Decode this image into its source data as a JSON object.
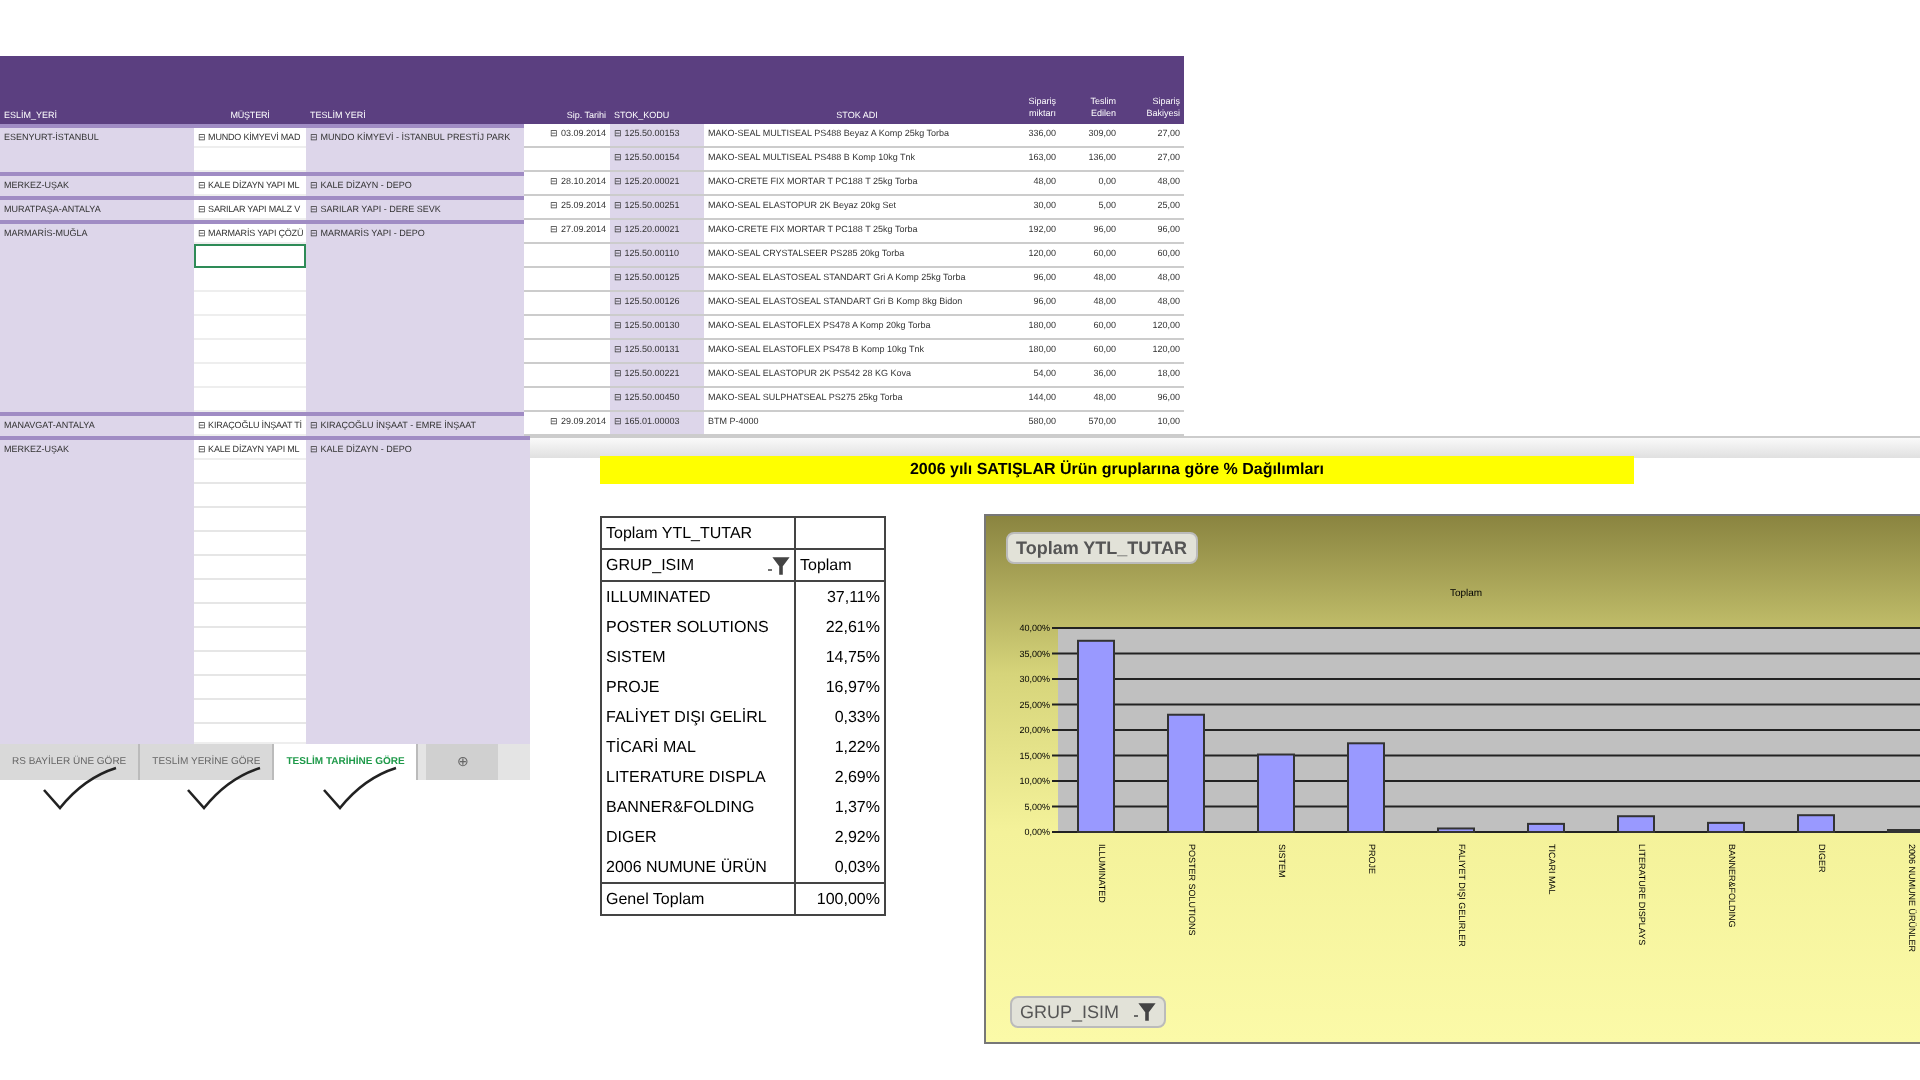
{
  "order_sheet": {
    "columns": [
      {
        "label": "ESLİM_YERİ"
      },
      {
        "label": "MÜŞTERİ"
      },
      {
        "label": "TESLİM YERİ"
      },
      {
        "label": "Sip. Tarihi"
      },
      {
        "label": "STOK_KODU"
      },
      {
        "label": "STOK ADI"
      },
      {
        "label": "Sipariş miktarı"
      },
      {
        "label": "Teslim Edilen"
      },
      {
        "label": "Sipariş Bakiyesi"
      }
    ],
    "rows": [
      {
        "location": "ESENYURT-İSTANBUL",
        "customer": "⊟ MUNDO KİMYEVİ MAD",
        "site": "⊟ MUNDO KİMYEVİ - İSTANBUL PRESTİJ PARK",
        "date": "⊟ 03.09.2014",
        "code": "⊟ 125.50.00153",
        "name": "MAKO-SEAL MULTISEAL PS488 Beyaz A Komp 25kg Torba",
        "ordered": "336,00",
        "delivered": "309,00",
        "balance": "27,00",
        "active": false
      },
      {
        "code": "⊟ 125.50.00154",
        "name": "MAKO-SEAL MULTISEAL PS488 B Komp 10kg Tnk",
        "ordered": "163,00",
        "delivered": "136,00",
        "balance": "27,00",
        "active": false
      },
      {
        "location": "MERKEZ-UŞAK",
        "customer": "⊟ KALE DİZAYN YAPI ML",
        "site": "⊟ KALE DİZAYN - DEPO",
        "date": "⊟ 28.10.2014",
        "code": "⊟ 125.20.00021",
        "name": "MAKO-CRETE FIX MORTAR T PC188 T 25kg Torba",
        "ordered": "48,00",
        "delivered": "0,00",
        "balance": "48,00",
        "active": false
      },
      {
        "location": "MURATPAŞA-ANTALYA",
        "customer": "⊟ SARILAR YAPI MALZ V",
        "site": "⊟ SARILAR YAPI - DERE SEVK",
        "date": "⊟ 25.09.2014",
        "code": "⊟ 125.50.00251",
        "name": "MAKO-SEAL ELASTOPUR 2K Beyaz 20kg Set",
        "ordered": "30,00",
        "delivered": "5,00",
        "balance": "25,00",
        "active": false
      },
      {
        "location": "MARMARİS-MUĞLA",
        "customer": "⊟ MARMARİS YAPI ÇÖZÜ",
        "site": "⊟ MARMARİS YAPI - DEPO",
        "date": "⊟ 27.09.2014",
        "code": "⊟ 125.20.00021",
        "name": "MAKO-CRETE FIX MORTAR T PC188 T 25kg Torba",
        "ordered": "192,00",
        "delivered": "96,00",
        "balance": "96,00",
        "active": false
      },
      {
        "code": "⊟ 125.50.00110",
        "name": "MAKO-SEAL CRYSTALSEER PS285 20kg Torba",
        "ordered": "120,00",
        "delivered": "60,00",
        "balance": "60,00",
        "active": true
      },
      {
        "code": "⊟ 125.50.00125",
        "name": "MAKO-SEAL ELASTOSEAL STANDART Gri A Komp 25kg Torba",
        "ordered": "96,00",
        "delivered": "48,00",
        "balance": "48,00",
        "active": false
      },
      {
        "code": "⊟ 125.50.00126",
        "name": "MAKO-SEAL ELASTOSEAL STANDART Gri B Komp 8kg Bidon",
        "ordered": "96,00",
        "delivered": "48,00",
        "balance": "48,00",
        "active": false
      },
      {
        "code": "⊟ 125.50.00130",
        "name": "MAKO-SEAL ELASTOFLEX PS478 A Komp 20kg Torba",
        "ordered": "180,00",
        "delivered": "60,00",
        "balance": "120,00",
        "active": false
      },
      {
        "code": "⊟ 125.50.00131",
        "name": "MAKO-SEAL ELASTOFLEX PS478 B Komp 10kg Tnk",
        "ordered": "180,00",
        "delivered": "60,00",
        "balance": "120,00",
        "active": false
      },
      {
        "code": "⊟ 125.50.00221",
        "name": "MAKO-SEAL ELASTOPUR 2K PS542 28 KG Kova",
        "ordered": "54,00",
        "delivered": "36,00",
        "balance": "18,00",
        "active": false
      },
      {
        "code": "⊟ 125.50.00450",
        "name": "MAKO-SEAL SULPHATSEAL PS275 25kg Torba",
        "ordered": "144,00",
        "delivered": "48,00",
        "balance": "96,00",
        "active": false
      },
      {
        "location": "MANAVGAT-ANTALYA",
        "customer": "⊟ KIRAÇOĞLU İNŞAAT Tİ",
        "site": "⊟ KIRAÇOĞLU İNŞAAT - EMRE İNŞAAT",
        "date": "⊟ 29.09.2014",
        "code": "⊟ 165.01.00003",
        "name": "BTM P-4000",
        "ordered": "580,00",
        "delivered": "570,00",
        "balance": "10,00",
        "active": false
      }
    ],
    "lower_rows": [
      {
        "location": "MERKEZ-UŞAK",
        "customer": "⊟ KALE DİZAYN YAPI ML",
        "site": "⊟ KALE DİZAYN - DEPO"
      }
    ],
    "sheet_tabs": [
      {
        "label": "RS BAYİLER ÜNE GÖRE",
        "selected": false
      },
      {
        "label": "TESLİM YERİNE GÖRE",
        "selected": false
      },
      {
        "label": "TESLİM TARİHİNE GÖRE",
        "selected": true
      }
    ],
    "add_sheet": "⊕"
  },
  "report": {
    "title": "2006 yılı SATIŞLAR Ürün gruplarına göre % Dağılımları",
    "pivot": {
      "measure": "Toplam YTL_TUTAR",
      "row_field": "GRUP_ISIM",
      "value_header": "Toplam",
      "rows": [
        {
          "label": "ILLUMINATED",
          "value": "37,11%"
        },
        {
          "label": "POSTER SOLUTIONS",
          "value": "22,61%"
        },
        {
          "label": "SISTEM",
          "value": "14,75%"
        },
        {
          "label": "PROJE",
          "value": "16,97%"
        },
        {
          "label": "FALİYET DIŞI GELİRL",
          "value": "0,33%"
        },
        {
          "label": "TİCARİ MAL",
          "value": "1,22%"
        },
        {
          "label": "LITERATURE DISPLA",
          "value": "2,69%"
        },
        {
          "label": "BANNER&FOLDING",
          "value": "1,37%"
        },
        {
          "label": "DIGER",
          "value": "2,92%"
        },
        {
          "label": "2006 NUMUNE ÜRÜN",
          "value": "0,03%"
        }
      ],
      "total_label": "Genel Toplam",
      "total_value": "100,00%"
    },
    "chart_button": "Toplam YTL_TUTAR",
    "chart_filter": "GRUP_ISIM",
    "chart_data": {
      "type": "bar",
      "title": "Toplam",
      "categories": [
        "ILLUMINATED",
        "POSTER SOLUTIONS",
        "SISTEM",
        "PROJE",
        "FALIYET DIŞI GELIRLER",
        "TICARI MAL",
        "LITERATURE DISPLAYS",
        "BANNER&FOLDING",
        "DIGER",
        "2006 NUMUNE ÜRÜNLER"
      ],
      "series": [
        {
          "color": "#9999ff",
          "values": [
            37.1,
            22.6,
            14.8,
            17.0,
            0.3,
            1.2,
            2.7,
            1.4,
            2.9,
            0.0
          ]
        }
      ],
      "grid": true,
      "ylim": [
        0,
        40
      ],
      "yticks": [
        {
          "value": 0,
          "label": "0,00%"
        },
        {
          "value": 5,
          "label": "5,00%"
        },
        {
          "value": 10,
          "label": "10,00%"
        },
        {
          "value": 15,
          "label": "15,00%"
        },
        {
          "value": 20,
          "label": "20,00%"
        },
        {
          "value": 25,
          "label": "25,00%"
        },
        {
          "value": 30,
          "label": "30,00%"
        },
        {
          "value": 35,
          "label": "35,00%"
        },
        {
          "value": 40,
          "label": "40,00%"
        }
      ]
    }
  }
}
